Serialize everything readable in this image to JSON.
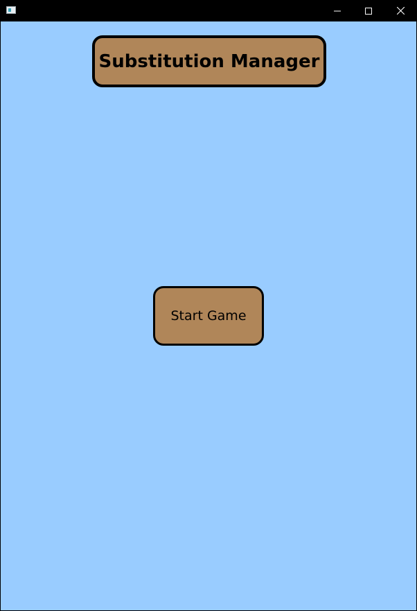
{
  "window": {
    "icon": "app-window-icon",
    "controls": {
      "minimize": "minimize-icon",
      "maximize": "maximize-icon",
      "close": "close-icon"
    }
  },
  "main": {
    "title": "Substitution Manager",
    "start_button_label": "Start Game"
  },
  "colors": {
    "background": "#99ccff",
    "panel": "#b08659",
    "border": "#000000"
  }
}
